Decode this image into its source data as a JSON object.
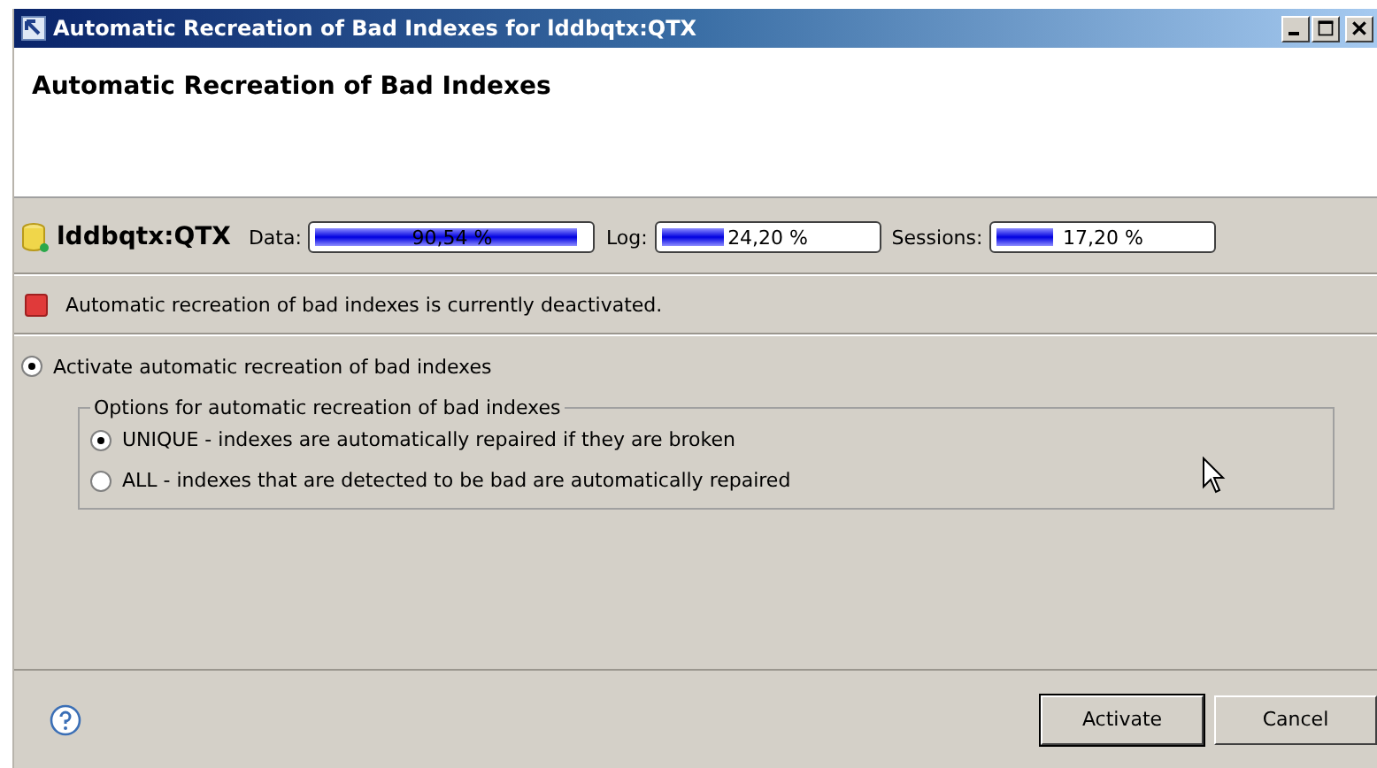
{
  "window": {
    "title": "Automatic Recreation of Bad Indexes for lddbqtx:QTX"
  },
  "header": {
    "title": "Automatic Recreation of Bad Indexes"
  },
  "database": {
    "name": "lddbqtx:QTX",
    "meters": [
      {
        "label": "Data:",
        "reading": "90,54 %",
        "level": 0.92
      },
      {
        "label": "Log:",
        "reading": "24,20 %",
        "level": 0.28
      },
      {
        "label": "Sessions:",
        "reading": "17,20 %",
        "level": 0.25
      }
    ]
  },
  "status": {
    "message": "Automatic recreation of bad indexes is currently deactivated.",
    "color": "#e03a3a"
  },
  "activate": {
    "label": "Activate automatic recreation of bad indexes",
    "selected": true
  },
  "options": {
    "title": "Options for automatic recreation of bad indexes",
    "items": [
      {
        "label": "UNIQUE - indexes are automatically repaired if they are broken",
        "selected": true
      },
      {
        "label": "ALL - indexes that are detected to be bad are automatically repaired",
        "selected": false
      }
    ]
  },
  "buttons": [
    {
      "label": "Activate",
      "default": true
    },
    {
      "label": "Cancel",
      "default": false
    }
  ]
}
